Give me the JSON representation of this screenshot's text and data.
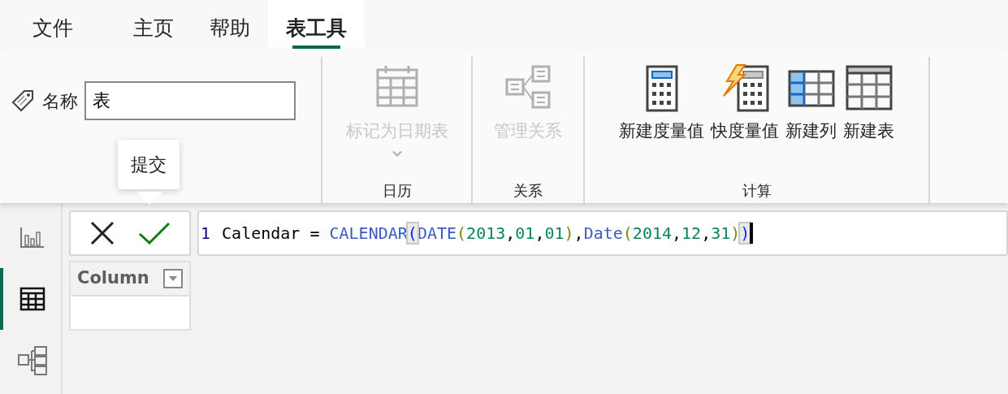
{
  "tabs": [
    {
      "label": "文件",
      "selected": false
    },
    {
      "label": "主页",
      "selected": false
    },
    {
      "label": "帮助",
      "selected": false
    },
    {
      "label": "表工具",
      "selected": true
    }
  ],
  "name_group": {
    "label": "名称",
    "value": "表"
  },
  "groups": [
    {
      "label": "日历",
      "buttons": [
        {
          "kind": "calendar",
          "label": "标记为日期表",
          "disabled": true,
          "dropdown": true
        }
      ]
    },
    {
      "label": "关系",
      "buttons": [
        {
          "kind": "relationships",
          "label": "管理关系",
          "disabled": true,
          "dropdown": false
        }
      ]
    },
    {
      "label": "计算",
      "buttons": [
        {
          "kind": "measure",
          "label": "新建度量值",
          "disabled": false,
          "dropdown": false
        },
        {
          "kind": "quick-measure",
          "label": "快度量值",
          "disabled": false,
          "dropdown": false
        },
        {
          "kind": "column",
          "label": "新建列",
          "disabled": false,
          "dropdown": false
        },
        {
          "kind": "table",
          "label": "新建表",
          "disabled": false,
          "dropdown": false
        }
      ]
    }
  ],
  "tooltip": "提交",
  "rail": [
    {
      "kind": "report",
      "selected": false
    },
    {
      "kind": "data",
      "selected": true
    },
    {
      "kind": "model",
      "selected": false
    }
  ],
  "formula": {
    "line_number": "1",
    "tokens": [
      {
        "kind": "text",
        "text": "Calendar = "
      },
      {
        "kind": "function",
        "text": "CALENDAR"
      },
      {
        "kind": "match-paren",
        "text": "("
      },
      {
        "kind": "function",
        "text": "DATE"
      },
      {
        "kind": "paren",
        "text": "("
      },
      {
        "kind": "number",
        "text": "2013"
      },
      {
        "kind": "text",
        "text": ","
      },
      {
        "kind": "number",
        "text": "01"
      },
      {
        "kind": "text",
        "text": ","
      },
      {
        "kind": "number",
        "text": "01"
      },
      {
        "kind": "paren",
        "text": ")"
      },
      {
        "kind": "text",
        "text": ","
      },
      {
        "kind": "function",
        "text": "Date"
      },
      {
        "kind": "paren",
        "text": "("
      },
      {
        "kind": "number",
        "text": "2014"
      },
      {
        "kind": "text",
        "text": ","
      },
      {
        "kind": "number",
        "text": "12"
      },
      {
        "kind": "text",
        "text": ","
      },
      {
        "kind": "number",
        "text": "31"
      },
      {
        "kind": "paren",
        "text": ")"
      },
      {
        "kind": "match-paren",
        "text": ")"
      }
    ]
  },
  "table": {
    "columns": [
      "Column"
    ]
  }
}
